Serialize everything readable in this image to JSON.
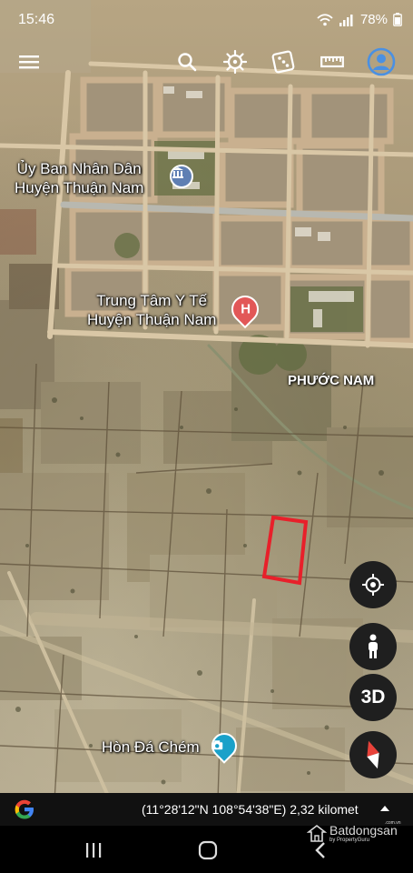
{
  "status_bar": {
    "time": "15:46",
    "battery": "78%"
  },
  "toolbar": {
    "icons": [
      "menu-icon",
      "search-icon",
      "voyager-wheel-icon",
      "dice-icon",
      "ruler-icon",
      "account-icon"
    ],
    "account_color": "#4a90e2"
  },
  "map": {
    "places": [
      {
        "line1": "Ủy Ban Nhân Dân",
        "line2": "Huyện Thuận Nam",
        "icon": "government-building-icon",
        "icon_color": "#5f7fb3"
      },
      {
        "line1": "Trung Tâm Y Tế",
        "line2": "Huyện Thuận Nam",
        "icon": "hospital-icon",
        "icon_color": "#e25757"
      },
      {
        "line1": "Hòn Đá Chém",
        "icon": "camera-icon",
        "icon_color": "#1aa1c9"
      }
    ],
    "area_label": "PHƯỚC NAM",
    "highlight_color": "#e8202a"
  },
  "controls": {
    "location": "my-location-icon",
    "pegman": "pegman-icon",
    "threed_label": "3D",
    "compass": "compass-icon"
  },
  "coord_bar": {
    "text": "(11°28'12\"N 108°54'38\"E) 2,32 kilomet"
  },
  "watermark": {
    "brand": "Batdongsan",
    "sub": "by PropertyGuru",
    "domain": ".com.vn"
  }
}
